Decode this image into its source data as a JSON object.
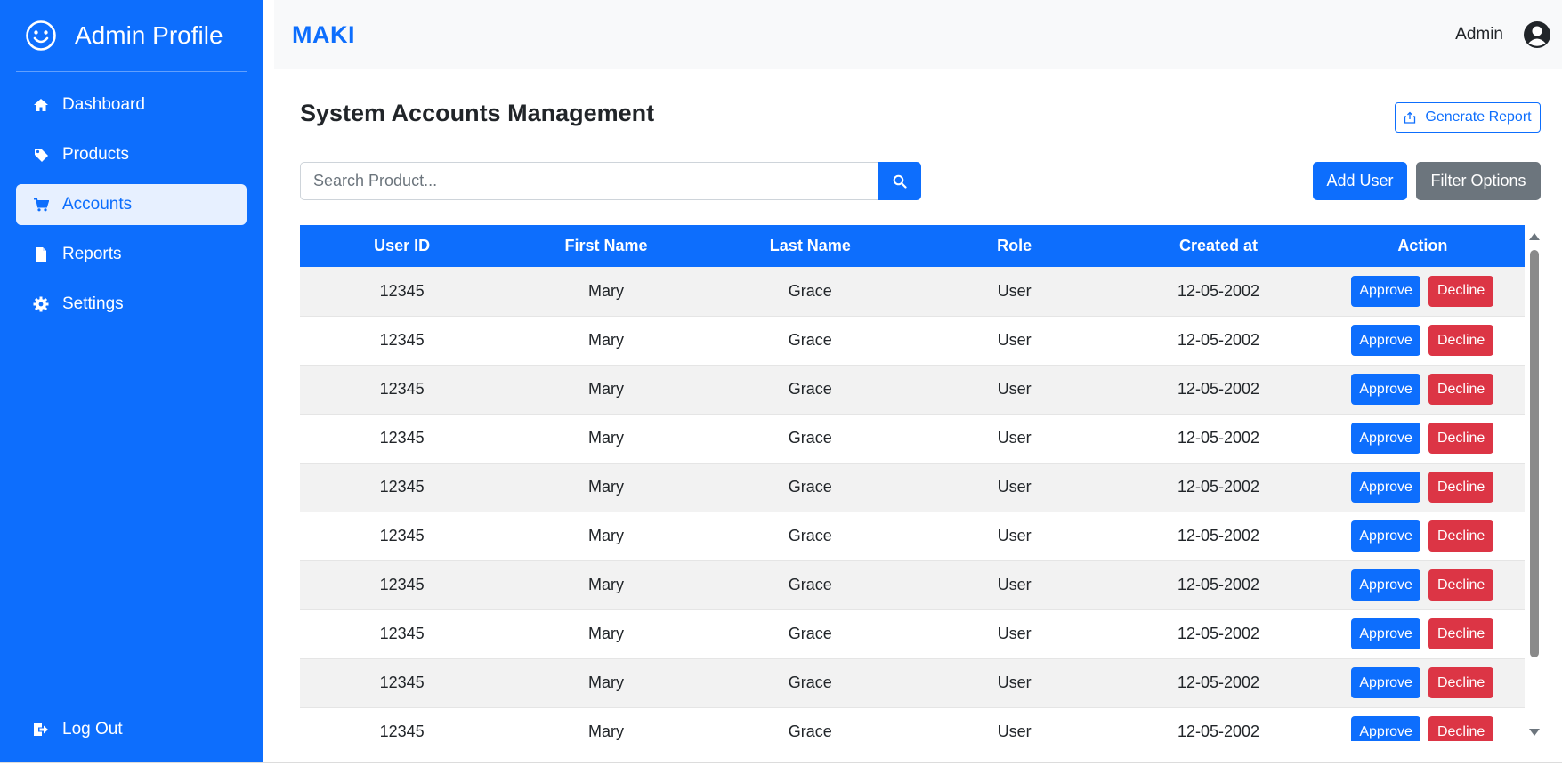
{
  "sidebar": {
    "title": "Admin Profile",
    "items": [
      {
        "label": "Dashboard",
        "icon": "home-icon"
      },
      {
        "label": "Products",
        "icon": "tag-icon"
      },
      {
        "label": "Accounts",
        "icon": "cart-icon",
        "active": true
      },
      {
        "label": "Reports",
        "icon": "file-icon"
      },
      {
        "label": "Settings",
        "icon": "gear-icon"
      }
    ],
    "logout_label": "Log Out"
  },
  "header": {
    "logo": "MAKI",
    "user_name": "Admin"
  },
  "main": {
    "title": "System Accounts Management",
    "report_button": "Generate Report",
    "search_placeholder": "Search Product...",
    "add_user_button": "Add User",
    "filter_button": "Filter Options"
  },
  "table": {
    "columns": [
      "User ID",
      "First Name",
      "Last Name",
      "Role",
      "Created at",
      "Action"
    ],
    "rows": [
      {
        "user_id": "12345",
        "first_name": "Mary",
        "last_name": "Grace",
        "role": "User",
        "created_at": "12-05-2002"
      },
      {
        "user_id": "12345",
        "first_name": "Mary",
        "last_name": "Grace",
        "role": "User",
        "created_at": "12-05-2002"
      },
      {
        "user_id": "12345",
        "first_name": "Mary",
        "last_name": "Grace",
        "role": "User",
        "created_at": "12-05-2002"
      },
      {
        "user_id": "12345",
        "first_name": "Mary",
        "last_name": "Grace",
        "role": "User",
        "created_at": "12-05-2002"
      },
      {
        "user_id": "12345",
        "first_name": "Mary",
        "last_name": "Grace",
        "role": "User",
        "created_at": "12-05-2002"
      },
      {
        "user_id": "12345",
        "first_name": "Mary",
        "last_name": "Grace",
        "role": "User",
        "created_at": "12-05-2002"
      },
      {
        "user_id": "12345",
        "first_name": "Mary",
        "last_name": "Grace",
        "role": "User",
        "created_at": "12-05-2002"
      },
      {
        "user_id": "12345",
        "first_name": "Mary",
        "last_name": "Grace",
        "role": "User",
        "created_at": "12-05-2002"
      },
      {
        "user_id": "12345",
        "first_name": "Mary",
        "last_name": "Grace",
        "role": "User",
        "created_at": "12-05-2002"
      },
      {
        "user_id": "12345",
        "first_name": "Mary",
        "last_name": "Grace",
        "role": "User",
        "created_at": "12-05-2002"
      }
    ],
    "approve_label": "Approve",
    "decline_label": "Decline"
  },
  "colors": {
    "primary": "#0d6efd",
    "danger": "#dc3545",
    "secondary": "#6c757d",
    "active_bg": "#e7f0ff"
  }
}
